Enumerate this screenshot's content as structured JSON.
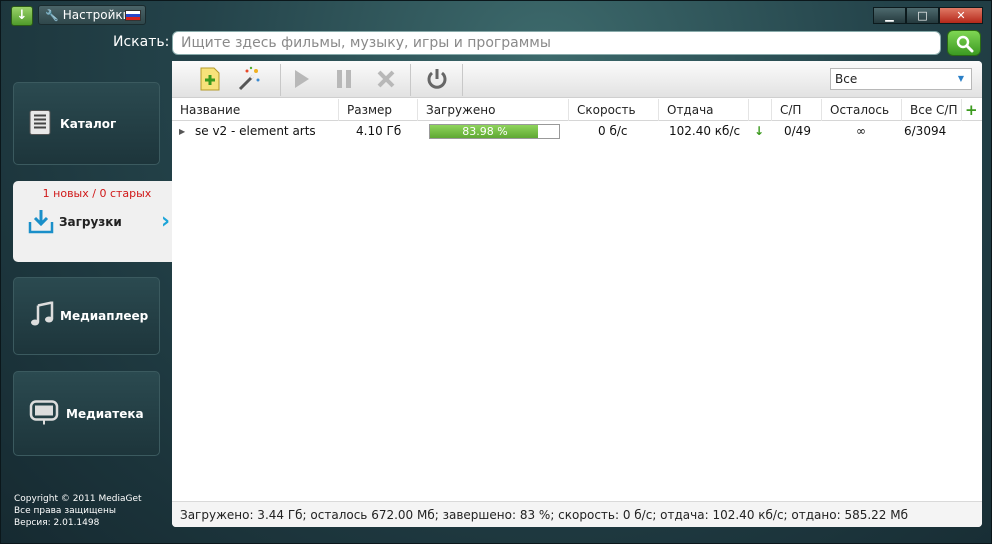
{
  "titlebar": {
    "settings_label": "Настройки",
    "minimize": "▁",
    "maximize": "□",
    "close": "✕"
  },
  "search": {
    "label": "Искать:",
    "placeholder": "Ищите здесь фильмы, музыку, игры и программы"
  },
  "sidebar": {
    "items": [
      {
        "label": "Каталог",
        "icon": "catalog-icon"
      },
      {
        "label": "Загрузки",
        "icon": "downloads-icon",
        "counts": "1 новых / 0 старых",
        "active": true
      },
      {
        "label": "Медиаплеер",
        "icon": "music-note-icon"
      },
      {
        "label": "Медиатека",
        "icon": "media-library-icon"
      }
    ],
    "copyright": [
      "Copyright © 2011 MediaGet",
      "Все права защищены",
      "Версия: 2.01.1498"
    ]
  },
  "toolbar": {
    "filter_value": "Все"
  },
  "table": {
    "columns": [
      "Название",
      "Размер",
      "Загружено",
      "Скорость",
      "Отдача",
      "С/П",
      "Осталось",
      "Все С/П"
    ],
    "rows": [
      {
        "name": "se v2 - element arts",
        "size": "4.10 Гб",
        "progress_text": "83.98 %",
        "progress": 83.98,
        "speed": "0 б/с",
        "upload": "102.40 кб/с",
        "seeds_peers": "0/49",
        "remaining": "∞",
        "all_seeds_peers": "6/3094"
      }
    ]
  },
  "status": "Загружено: 3.44 Гб; осталось 672.00 Мб; завершено: 83 %; скорость: 0 б/с; отдача: 102.40 кб/с; отдано: 585.22 Мб",
  "colors": {
    "accent_green": "#5fa833",
    "counts_red": "#d01818",
    "chevron_blue": "#1ba4d8"
  }
}
